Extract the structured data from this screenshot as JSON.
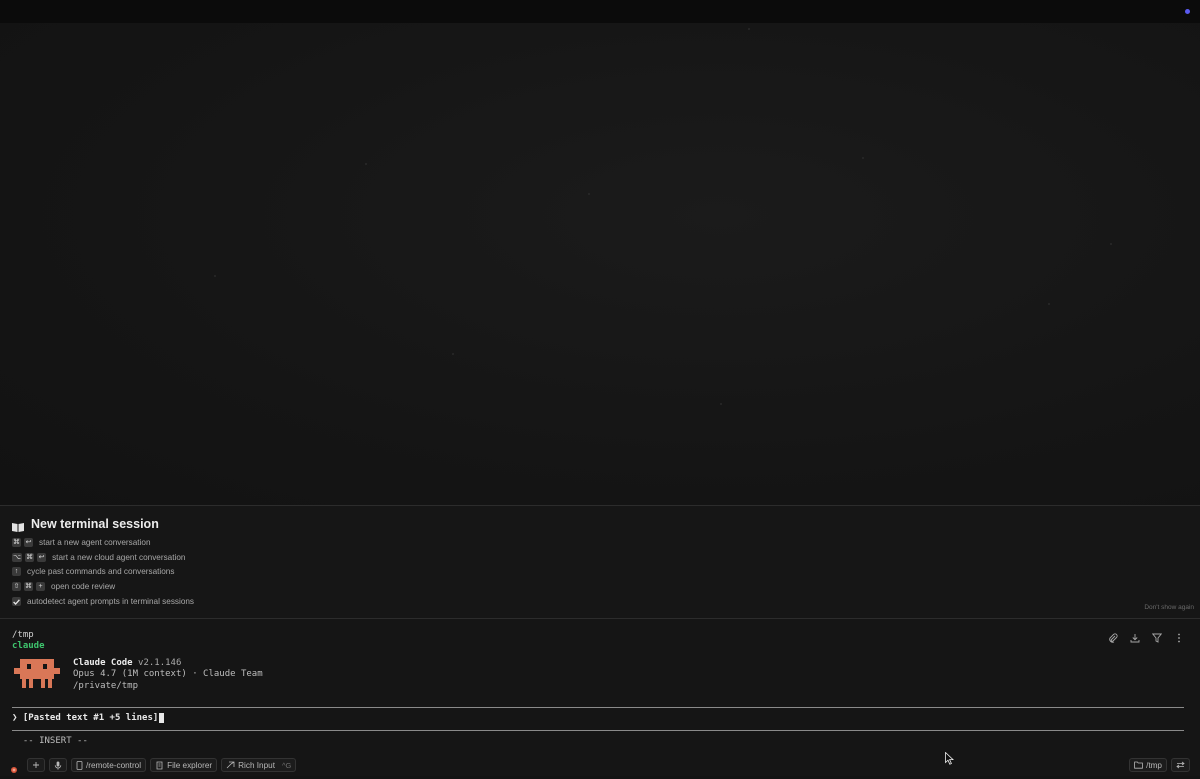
{
  "welcome": {
    "title": "New terminal session",
    "hints": [
      {
        "keys": [
          "⌘",
          "↩"
        ],
        "label": "start a new agent conversation"
      },
      {
        "keys": [
          "⌥",
          "⌘",
          "↩"
        ],
        "label": "start a new cloud agent conversation"
      },
      {
        "keys": [
          "↑"
        ],
        "label": "cycle past commands and conversations"
      },
      {
        "keys": [
          "⇧",
          "⌘",
          "+"
        ],
        "label": "open code review"
      }
    ],
    "autodetect_label": "autodetect agent prompts in terminal sessions",
    "autodetect_checked": true,
    "dont_show": "Don't show again"
  },
  "terminal": {
    "cwd": "/tmp",
    "command": "claude",
    "app_name": "Claude Code",
    "version": "v2.1.146",
    "model_line": "Opus 4.7 (1M context) · Claude Team",
    "path_line": "/private/tmp",
    "prompt_symbol": "❯",
    "prompt_text": "[Pasted text #1 +5 lines]",
    "mode": "-- INSERT --"
  },
  "statusbar": {
    "remote_control": "/remote-control",
    "file_explorer": "File explorer",
    "rich_input": "Rich Input",
    "rich_input_shortcut": "^G",
    "dir": "/tmp"
  },
  "colors": {
    "accent": "#5a5af0",
    "command_green": "#3ec46d",
    "mascot": "#d97757"
  }
}
